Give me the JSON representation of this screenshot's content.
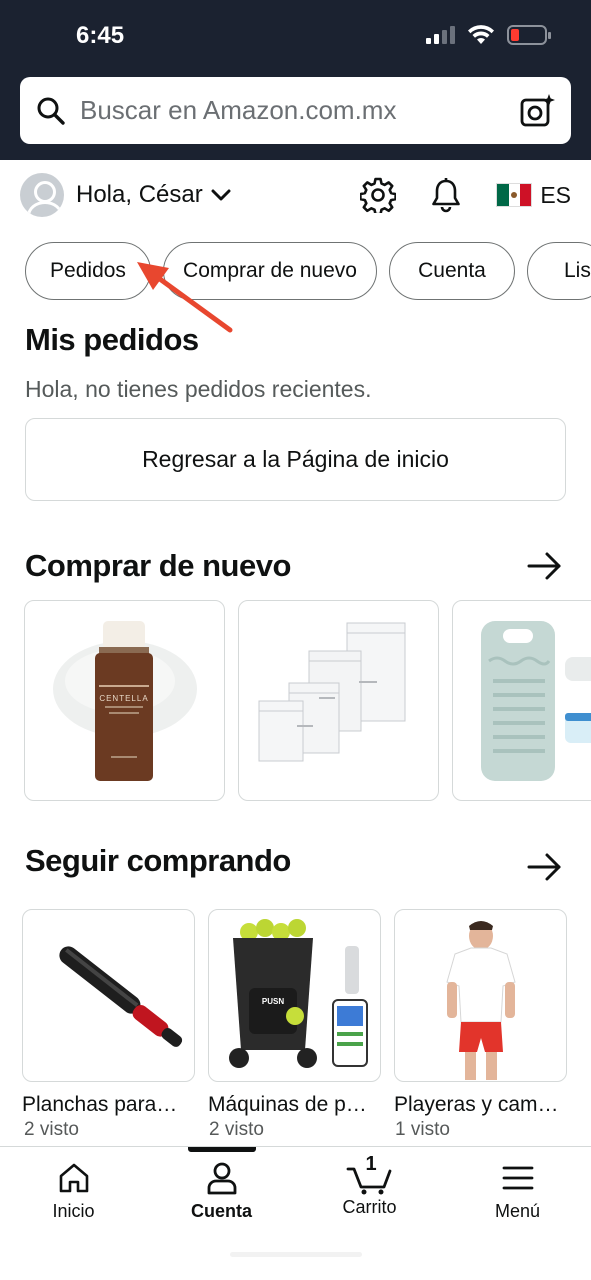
{
  "status_bar": {
    "time": "6:45"
  },
  "search": {
    "placeholder": "Buscar en Amazon.com.mx"
  },
  "account": {
    "greeting": "Hola, César",
    "language": "ES"
  },
  "chips": [
    "Pedidos",
    "Comprar de nuevo",
    "Cuenta",
    "Lis"
  ],
  "orders": {
    "title": "Mis pedidos",
    "empty_message": "Hola, no tienes pedidos recientes.",
    "home_button": "Regresar a la Página de inicio"
  },
  "buy_again": {
    "title": "Comprar de nuevo"
  },
  "keep_shopping": {
    "title": "Seguir comprando",
    "items": [
      {
        "caption": "Planchas para…",
        "seen": "2 visto"
      },
      {
        "caption": "Máquinas de p…",
        "seen": "2 visto"
      },
      {
        "caption": "Playeras y cam…",
        "seen": "1 visto"
      }
    ]
  },
  "product_labels": {
    "serum": "CENTELLA",
    "machine": "PUSN"
  },
  "nav": {
    "home": "Inicio",
    "account": "Cuenta",
    "cart": "Carrito",
    "cart_count": "1",
    "menu": "Menú"
  },
  "colors": {
    "header_bg": "#1b2230",
    "annotation_arrow": "#e8472f",
    "battery_low": "#ff3b30"
  }
}
